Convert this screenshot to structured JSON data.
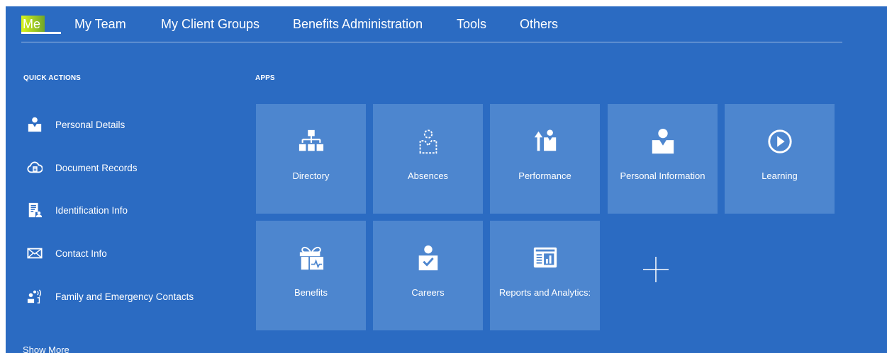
{
  "nav": {
    "tabs": [
      "Me",
      "My Team",
      "My Client Groups",
      "Benefits Administration",
      "Tools",
      "Others"
    ],
    "active_tab": "Me"
  },
  "quick_actions": {
    "title": "QUICK ACTIONS",
    "items": [
      {
        "label": "Personal Details",
        "icon": "person-icon"
      },
      {
        "label": "Document Records",
        "icon": "cloud-document-icon"
      },
      {
        "label": "Identification Info",
        "icon": "id-document-icon"
      },
      {
        "label": "Contact Info",
        "icon": "envelope-icon"
      },
      {
        "label": "Family and Emergency Contacts",
        "icon": "family-contacts-icon"
      }
    ],
    "show_more": "Show More"
  },
  "apps": {
    "title": "APPS",
    "tiles": [
      {
        "label": "Directory",
        "icon": "org-chart-icon"
      },
      {
        "label": "Absences",
        "icon": "absent-person-icon"
      },
      {
        "label": "Performance",
        "icon": "performance-icon"
      },
      {
        "label": "Personal Information",
        "icon": "person-icon"
      },
      {
        "label": "Learning",
        "icon": "play-circle-icon"
      },
      {
        "label": "Benefits",
        "icon": "gift-heartbeat-icon"
      },
      {
        "label": "Careers",
        "icon": "person-check-icon"
      },
      {
        "label": "Reports and Analytics:",
        "icon": "report-chart-icon"
      }
    ]
  },
  "colors": {
    "background": "#2b6bc2",
    "tile": "#4d86cf",
    "highlight": "#b7e01f"
  }
}
